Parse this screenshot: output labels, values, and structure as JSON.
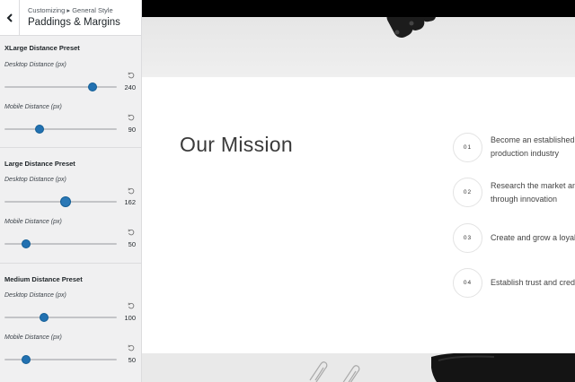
{
  "sidebar": {
    "breadcrumb": "Customizing ▸ General Style",
    "title": "Paddings & Margins",
    "presets": [
      {
        "title": "XLarge Distance Preset",
        "controls": [
          {
            "label": "Desktop Distance (px)",
            "value": "240",
            "fraction": 0.78
          },
          {
            "label": "Mobile Distance (px)",
            "value": "90",
            "fraction": 0.31
          }
        ]
      },
      {
        "title": "Large Distance Preset",
        "controls": [
          {
            "label": "Desktop Distance (px)",
            "value": "162",
            "fraction": 0.54
          },
          {
            "label": "Mobile Distance (px)",
            "value": "50",
            "fraction": 0.19
          }
        ]
      },
      {
        "title": "Medium Distance Preset",
        "controls": [
          {
            "label": "Desktop Distance (px)",
            "value": "100",
            "fraction": 0.35
          },
          {
            "label": "Mobile Distance (px)",
            "value": "50",
            "fraction": 0.19
          }
        ]
      }
    ]
  },
  "preview": {
    "mission_title": "Our Mission",
    "items": [
      {
        "number": "01",
        "line1": "Become an established l",
        "line2": "production industry"
      },
      {
        "number": "02",
        "line1": "Research the market and",
        "line2": "through innovation"
      },
      {
        "number": "03",
        "line1": "Create and grow a loyal",
        "line2": ""
      },
      {
        "number": "04",
        "line1": "Establish trust and credi",
        "line2": ""
      }
    ]
  },
  "colors": {
    "slider_accent": "#2271b1",
    "sidebar_bg": "#f0f0f1",
    "top_bar": "#000000"
  },
  "icons": {
    "back": "chevron-left-icon",
    "reset": "undo-arrow-icon"
  }
}
